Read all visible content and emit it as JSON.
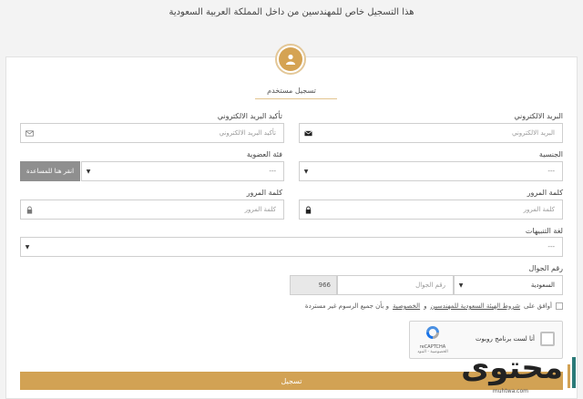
{
  "page": {
    "title": "هذا التسجيل خاص للمهندسين من داخل المملكة العربية السعودية",
    "register_heading": "تسجيل مستخدم"
  },
  "form": {
    "email": {
      "label": "البريد الالكتروني",
      "placeholder": "البريد الالكتروني"
    },
    "email_confirm": {
      "label": "تأكيد البريد الالكتروني",
      "placeholder": "تأكيد البريد الالكتروني"
    },
    "nationality": {
      "label": "الجنسية",
      "value": "---"
    },
    "membership": {
      "label": "فئة العضوية",
      "value": "---"
    },
    "help_button": "انقر هنا للمساعدة",
    "password": {
      "label": "كلمة المرور",
      "placeholder": "كلمة المرور"
    },
    "password_confirm": {
      "label": "كلمة المرور",
      "placeholder": "كلمة المرور"
    },
    "notify_lang": {
      "label": "لغة التنبيهات",
      "value": "---"
    },
    "mobile": {
      "label": "رقم الجوال",
      "country": "السعودية",
      "placeholder": "رقم الجوال",
      "code": "966"
    },
    "agree": {
      "prefix": "أوافق على",
      "terms_link": "شروط الهيئة السعودية للمهندسين",
      "and": "و",
      "privacy_link": "الخصوصية",
      "suffix": "و بأن جميع الرسوم غير مستردة"
    },
    "captcha": {
      "text": "أنا لست برنامج روبوت",
      "brand": "reCAPTCHA",
      "terms": "الخصوصية - البنود"
    },
    "submit_label": "تسجيل"
  },
  "watermark": {
    "text": "محتوى",
    "url": "muhtwa.com"
  },
  "colors": {
    "accent": "#d2a254",
    "help_button": "#8f8f8f"
  },
  "icons": {
    "avatar": "user-icon",
    "email": "envelope-icon",
    "password": "lock-icon"
  }
}
